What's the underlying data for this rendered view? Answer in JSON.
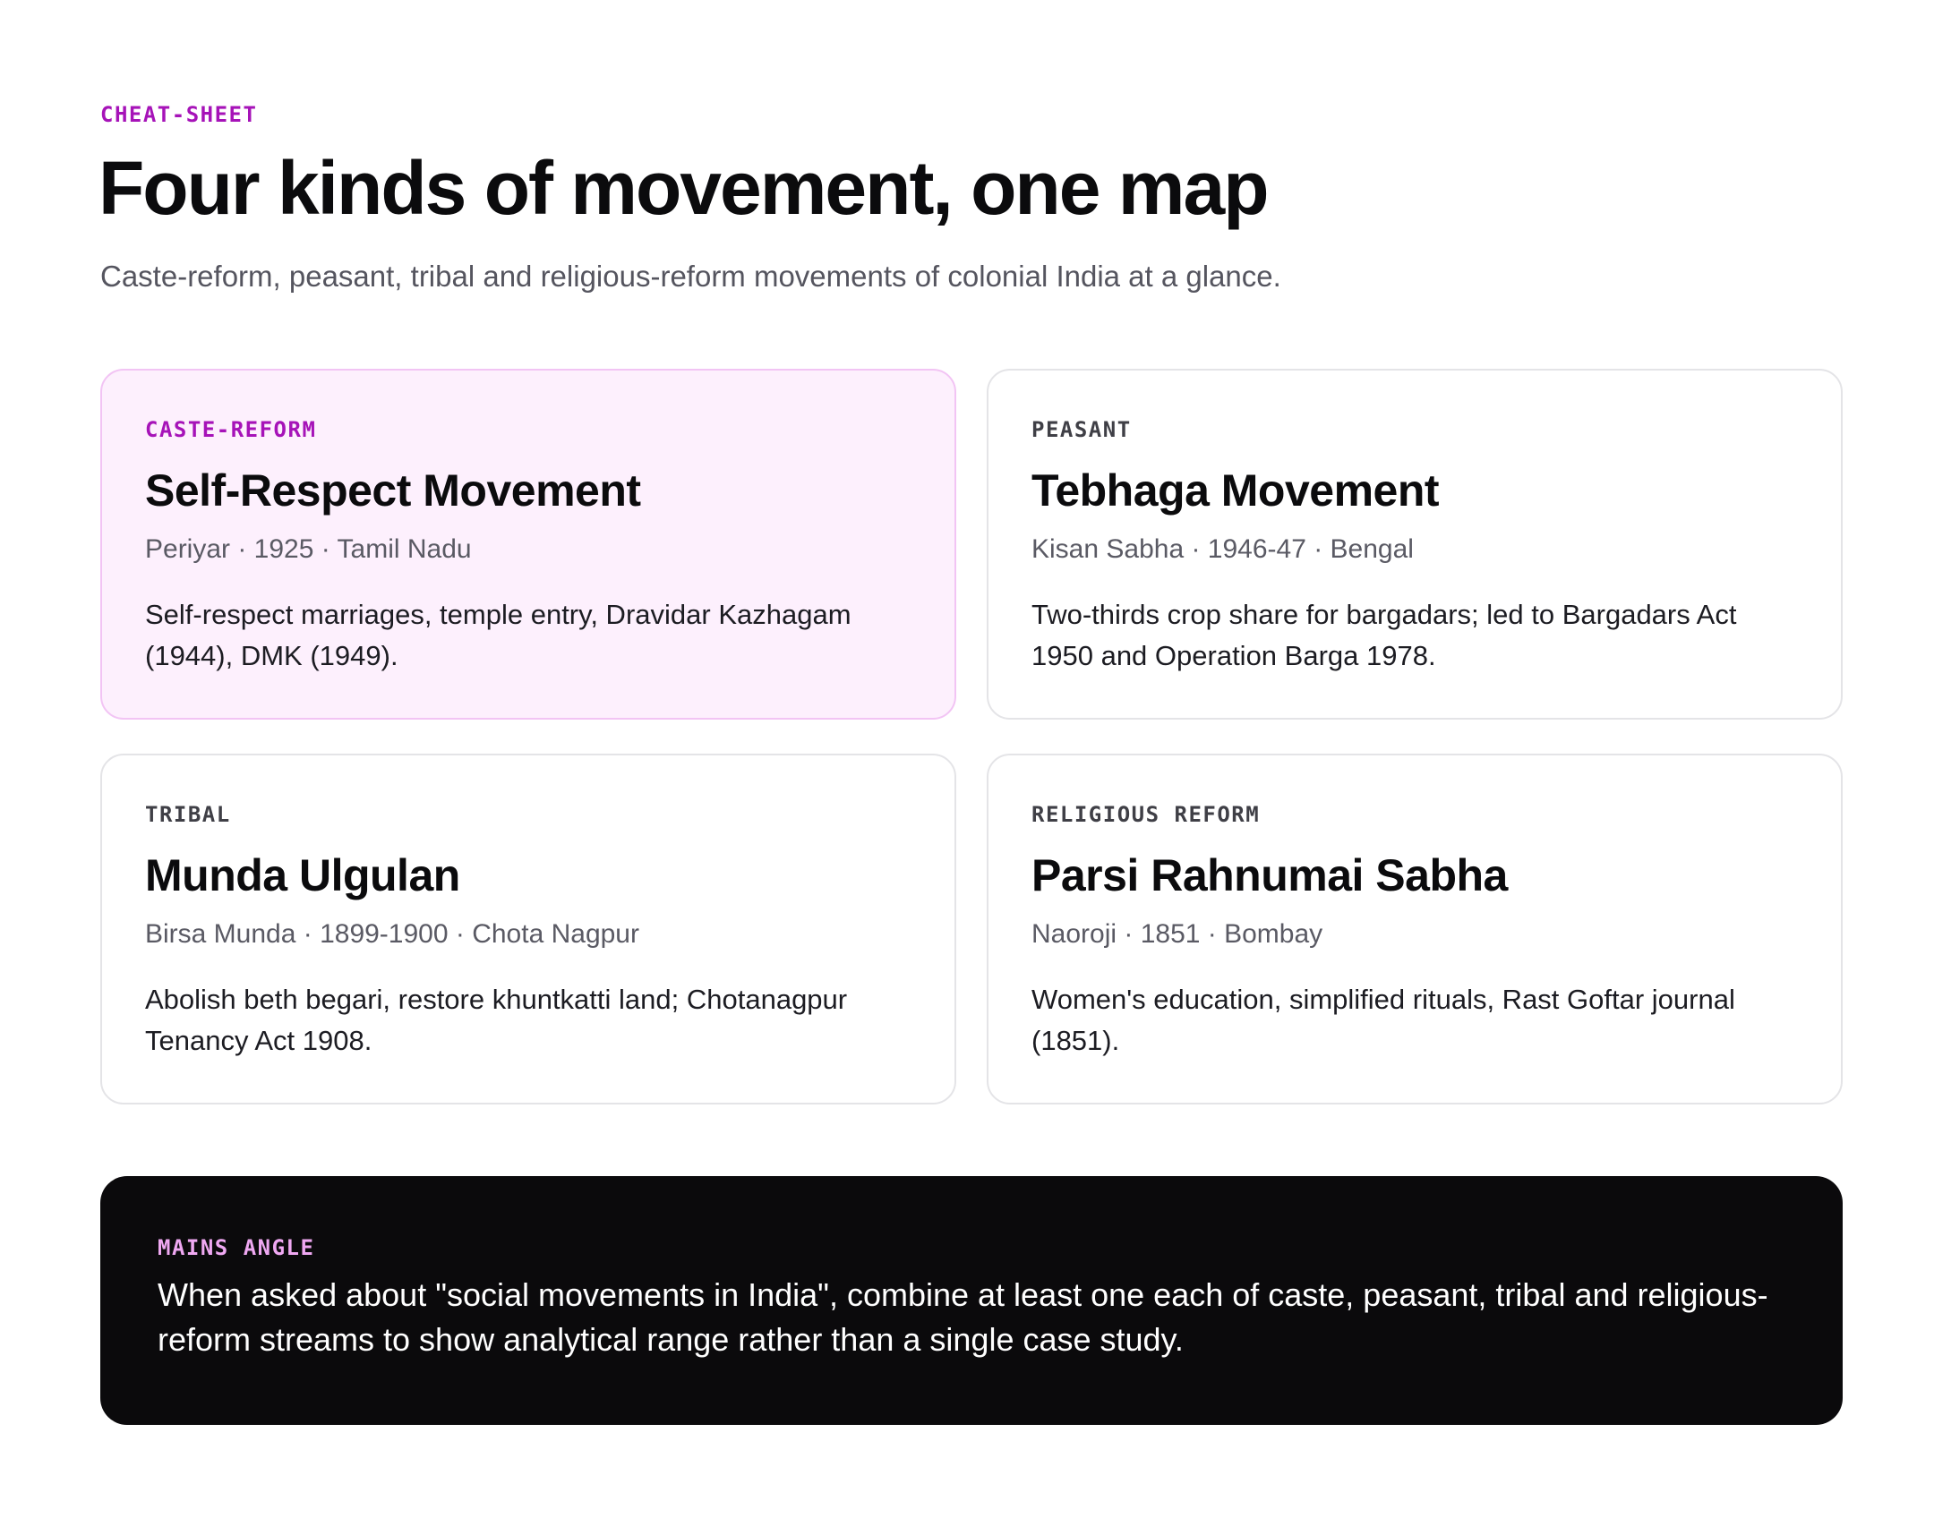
{
  "header": {
    "eyebrow": "CHEAT-SHEET",
    "title": "Four kinds of movement, one map",
    "subtitle": "Caste-reform, peasant, tribal and religious-reform movements of colonial India at a glance."
  },
  "cards": [
    {
      "tag": "CASTE-REFORM",
      "title": "Self-Respect Movement",
      "meta": "Periyar · 1925 · Tamil Nadu",
      "description": "Self-respect marriages, temple entry, Dravidar Kazhagam (1944), DMK (1949)."
    },
    {
      "tag": "PEASANT",
      "title": "Tebhaga Movement",
      "meta": "Kisan Sabha · 1946-47 · Bengal",
      "description": "Two-thirds crop share for bargadars; led to Bargadars Act 1950 and Operation Barga 1978."
    },
    {
      "tag": "TRIBAL",
      "title": "Munda Ulgulan",
      "meta": "Birsa Munda · 1899-1900 · Chota Nagpur",
      "description": "Abolish beth begari, restore khuntkatti land; Chotanagpur Tenancy Act 1908."
    },
    {
      "tag": "RELIGIOUS REFORM",
      "title": "Parsi Rahnumai Sabha",
      "meta": "Naoroji · 1851 · Bombay",
      "description": "Women's education, simplified rituals, Rast Goftar journal (1851)."
    }
  ],
  "callout": {
    "tag": "MAINS ANGLE",
    "text": "When asked about \"social movements in India\", combine at least one each of caste, peasant, tribal and religious-reform streams to show analytical range rather than a single case study."
  },
  "colors": {
    "accent": "#a613b8",
    "highlight_bg": "#fdf0fd",
    "highlight_border": "#f2c4f4",
    "callout_bg": "#0b0a0c",
    "callout_tag": "#efa8f2"
  }
}
